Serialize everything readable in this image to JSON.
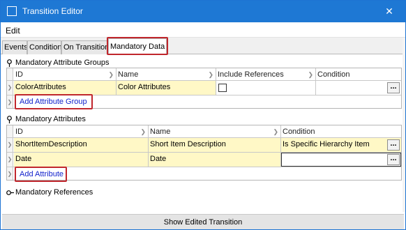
{
  "window": {
    "title": "Transition Editor",
    "close_glyph": "✕",
    "accent": "#1e78d4"
  },
  "menu": {
    "edit": "Edit"
  },
  "tabs": [
    "Events",
    "Condition",
    "On Transition",
    "Mandatory Data"
  ],
  "groups": {
    "header": "Mandatory Attribute Groups",
    "columns": [
      "ID",
      "Name",
      "Include References",
      "Condition"
    ],
    "rows": [
      {
        "id": "ColorAttributes",
        "name": "Color Attributes",
        "include_references": false,
        "condition": ""
      }
    ],
    "add_label": "Add Attribute Group"
  },
  "attributes": {
    "header": "Mandatory Attributes",
    "columns": [
      "ID",
      "Name",
      "Condition"
    ],
    "rows": [
      {
        "id": "ShortItemDescription",
        "name": "Short Item Description",
        "condition": "Is Specific Hierarchy Item"
      },
      {
        "id": "Date",
        "name": "Date",
        "condition": ""
      }
    ],
    "add_label": "Add Attribute"
  },
  "references": {
    "header": "Mandatory References"
  },
  "footer": {
    "button_label": "Show Edited Transition"
  },
  "highlight_color": "#c0262c"
}
